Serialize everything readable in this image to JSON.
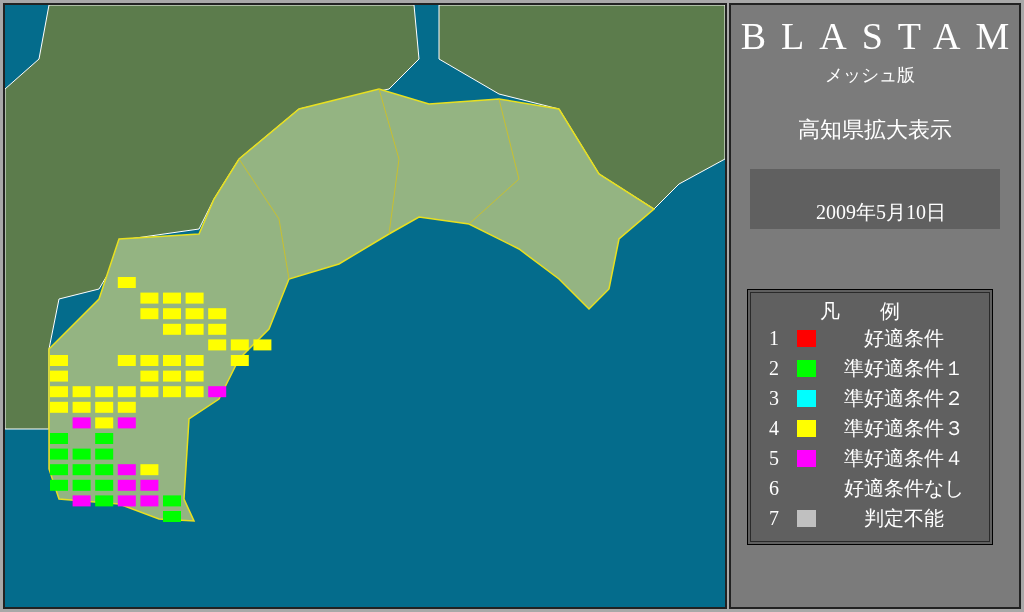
{
  "header": {
    "title": "BLASTAM",
    "subtitle": "メッシュ版",
    "region": "高知県拡大表示",
    "date": "2009年5月10日"
  },
  "legend": {
    "title": "凡　　例",
    "items": [
      {
        "number": "1",
        "label": "好適条件",
        "color": "#ff0000"
      },
      {
        "number": "2",
        "label": "準好適条件１",
        "color": "#00ff00"
      },
      {
        "number": "3",
        "label": "準好適条件２",
        "color": "#00ffff"
      },
      {
        "number": "4",
        "label": "準好適条件３",
        "color": "#ffff00"
      },
      {
        "number": "5",
        "label": "準好適条件４",
        "color": "#ff00ff"
      },
      {
        "number": "6",
        "label": "好適条件なし"
      },
      {
        "number": "7",
        "label": "判定不能",
        "color": "#c0c0c0"
      }
    ]
  },
  "mesh_rows": [
    [
      {
        "kind": "none"
      },
      {
        "kind": "none"
      },
      {
        "kind": "none"
      },
      {
        "kind": "cell",
        "color": "#ffff00"
      }
    ],
    [
      {
        "kind": "none"
      },
      {
        "kind": "none"
      },
      {
        "kind": "none"
      },
      {
        "kind": "none"
      },
      {
        "kind": "cell",
        "color": "#ffff00"
      },
      {
        "kind": "cell",
        "color": "#ffff00"
      },
      {
        "kind": "cell",
        "color": "#ffff00"
      }
    ],
    [
      {
        "kind": "none"
      },
      {
        "kind": "none"
      },
      {
        "kind": "none"
      },
      {
        "kind": "none"
      },
      {
        "kind": "cell",
        "color": "#ffff00"
      },
      {
        "kind": "cell",
        "color": "#ffff00"
      },
      {
        "kind": "cell",
        "color": "#ffff00"
      },
      {
        "kind": "cell",
        "color": "#ffff00"
      }
    ],
    [
      {
        "kind": "none"
      },
      {
        "kind": "none"
      },
      {
        "kind": "none"
      },
      {
        "kind": "none"
      },
      {
        "kind": "none"
      },
      {
        "kind": "cell",
        "color": "#ffff00"
      },
      {
        "kind": "cell",
        "color": "#ffff00"
      },
      {
        "kind": "cell",
        "color": "#ffff00"
      }
    ],
    [
      {
        "kind": "none"
      },
      {
        "kind": "none"
      },
      {
        "kind": "none"
      },
      {
        "kind": "none"
      },
      {
        "kind": "none"
      },
      {
        "kind": "none"
      },
      {
        "kind": "none"
      },
      {
        "kind": "cell",
        "color": "#ffff00"
      },
      {
        "kind": "cell",
        "color": "#ffff00"
      },
      {
        "kind": "cell",
        "color": "#ffff00"
      }
    ],
    [
      {
        "kind": "cell",
        "color": "#ffff00"
      },
      {
        "kind": "none"
      },
      {
        "kind": "none"
      },
      {
        "kind": "cell",
        "color": "#ffff00"
      },
      {
        "kind": "cell",
        "color": "#ffff00"
      },
      {
        "kind": "cell",
        "color": "#ffff00"
      },
      {
        "kind": "cell",
        "color": "#ffff00"
      },
      {
        "kind": "none"
      },
      {
        "kind": "cell",
        "color": "#ffff00"
      }
    ],
    [
      {
        "kind": "cell",
        "color": "#ffff00"
      },
      {
        "kind": "none"
      },
      {
        "kind": "none"
      },
      {
        "kind": "none"
      },
      {
        "kind": "cell",
        "color": "#ffff00"
      },
      {
        "kind": "cell",
        "color": "#ffff00"
      },
      {
        "kind": "cell",
        "color": "#ffff00"
      }
    ],
    [
      {
        "kind": "cell",
        "color": "#ffff00"
      },
      {
        "kind": "cell",
        "color": "#ffff00"
      },
      {
        "kind": "cell",
        "color": "#ffff00"
      },
      {
        "kind": "cell",
        "color": "#ffff00"
      },
      {
        "kind": "cell",
        "color": "#ffff00"
      },
      {
        "kind": "cell",
        "color": "#ffff00"
      },
      {
        "kind": "cell",
        "color": "#ffff00"
      },
      {
        "kind": "cell",
        "color": "#ff00ff"
      }
    ],
    [
      {
        "kind": "cell",
        "color": "#ffff00"
      },
      {
        "kind": "cell",
        "color": "#ffff00"
      },
      {
        "kind": "cell",
        "color": "#ffff00"
      },
      {
        "kind": "cell",
        "color": "#ffff00"
      }
    ],
    [
      {
        "kind": "none"
      },
      {
        "kind": "cell",
        "color": "#ff00ff"
      },
      {
        "kind": "cell",
        "color": "#ffff00"
      },
      {
        "kind": "cell",
        "color": "#ff00ff"
      }
    ],
    [
      {
        "kind": "cell",
        "color": "#00ff00"
      },
      {
        "kind": "none"
      },
      {
        "kind": "cell",
        "color": "#00ff00"
      }
    ],
    [
      {
        "kind": "cell",
        "color": "#00ff00"
      },
      {
        "kind": "cell",
        "color": "#00ff00"
      },
      {
        "kind": "cell",
        "color": "#00ff00"
      }
    ],
    [
      {
        "kind": "cell",
        "color": "#00ff00"
      },
      {
        "kind": "cell",
        "color": "#00ff00"
      },
      {
        "kind": "cell",
        "color": "#00ff00"
      },
      {
        "kind": "cell",
        "color": "#ff00ff"
      },
      {
        "kind": "cell",
        "color": "#ffff00"
      }
    ],
    [
      {
        "kind": "cell",
        "color": "#00ff00"
      },
      {
        "kind": "cell",
        "color": "#00ff00"
      },
      {
        "kind": "cell",
        "color": "#00ff00"
      },
      {
        "kind": "cell",
        "color": "#ff00ff"
      },
      {
        "kind": "cell",
        "color": "#ff00ff"
      }
    ],
    [
      {
        "kind": "none"
      },
      {
        "kind": "cell",
        "color": "#ff00ff"
      },
      {
        "kind": "cell",
        "color": "#00ff00"
      },
      {
        "kind": "cell",
        "color": "#ff00ff"
      },
      {
        "kind": "cell",
        "color": "#ff00ff"
      },
      {
        "kind": "cell",
        "color": "#00ff00"
      }
    ],
    [
      {
        "kind": "none"
      },
      {
        "kind": "none"
      },
      {
        "kind": "none"
      },
      {
        "kind": "none"
      },
      {
        "kind": "none"
      },
      {
        "kind": "cell",
        "color": "#00ff00"
      }
    ]
  ]
}
